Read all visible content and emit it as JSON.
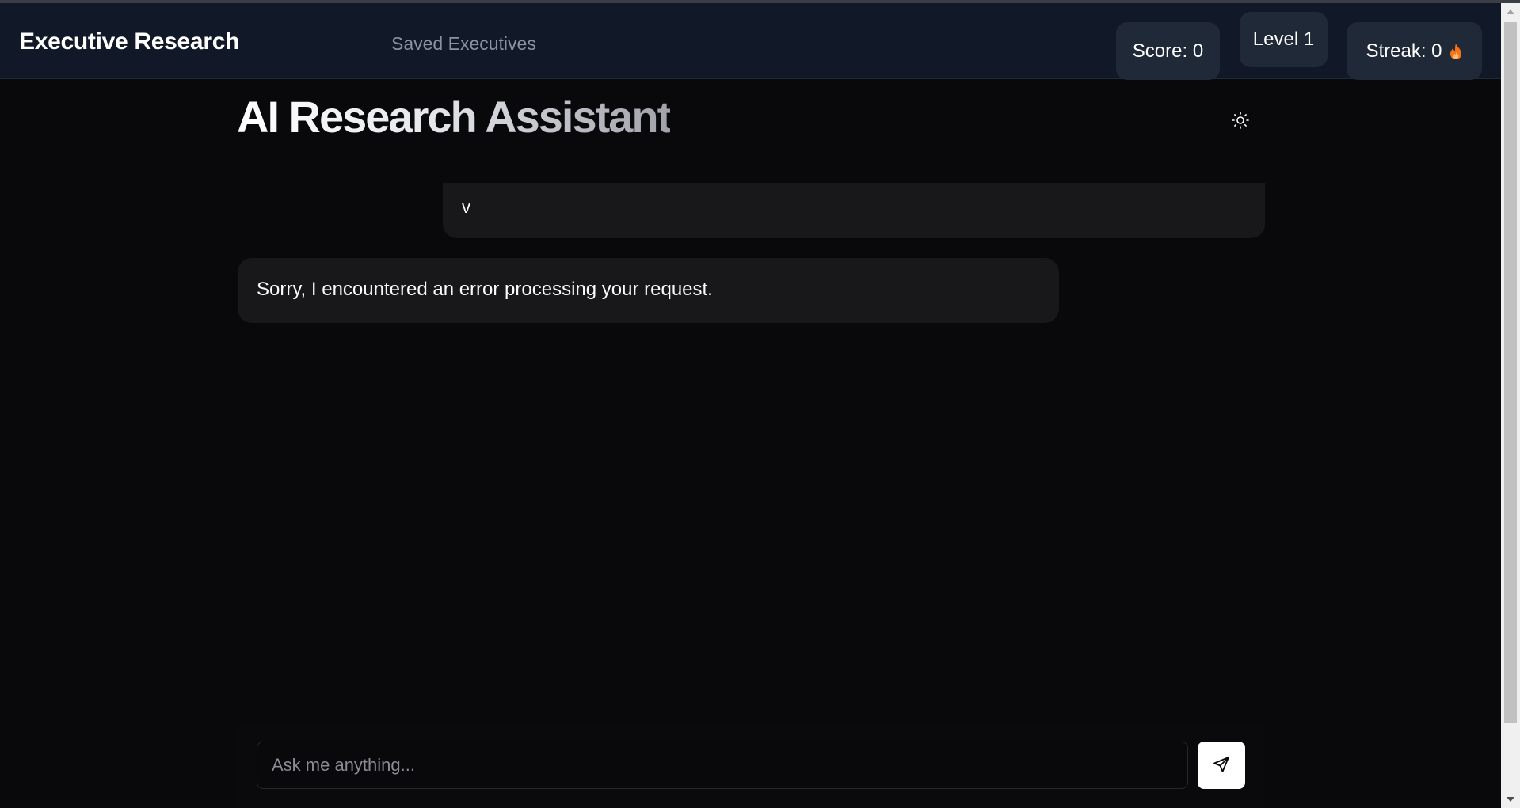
{
  "navbar": {
    "brand": "Executive Research",
    "links": [
      {
        "label": "Saved Executives"
      }
    ],
    "stats": {
      "score": "Score: 0",
      "level": "Level 1",
      "streak": "Streak: 0"
    },
    "icons": {
      "streak": "flame-icon"
    }
  },
  "main": {
    "title": "AI Research Assistant",
    "theme_toggle_icon": "sun-icon",
    "messages": [
      {
        "role": "user",
        "text": "v"
      },
      {
        "role": "assistant",
        "text": "Sorry, I encountered an error processing your request."
      }
    ]
  },
  "composer": {
    "placeholder": "Ask me anything...",
    "value": "",
    "send_icon": "send-icon"
  },
  "colors": {
    "background": "#09090b",
    "navbar": "#111827",
    "badge": "#1f2937",
    "bubble": "#18181b",
    "flame": "#f97316"
  }
}
